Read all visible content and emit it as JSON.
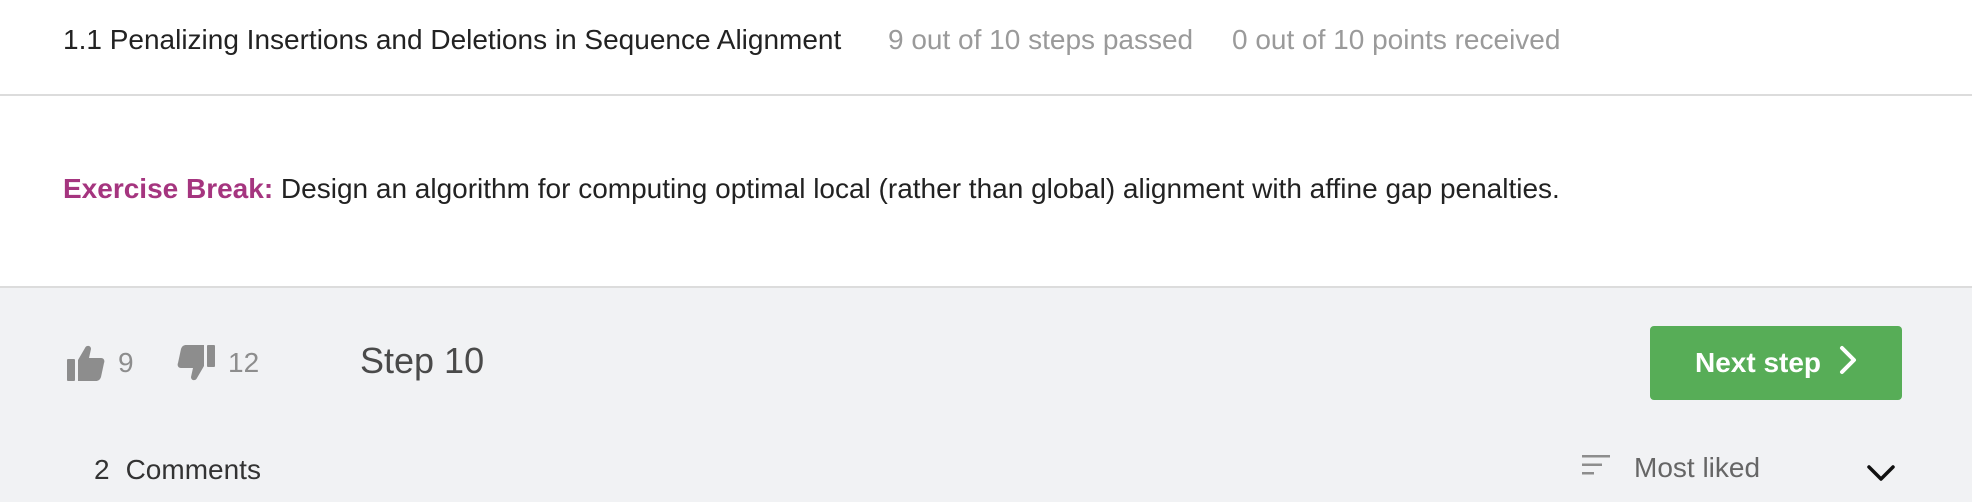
{
  "header": {
    "lesson_title": "1.1 Penalizing Insertions and Deletions in Sequence Alignment",
    "steps_passed": "9 out of 10 steps passed",
    "points_received": "0 out of 10 points  received"
  },
  "content": {
    "exercise_label": "Exercise Break:",
    "exercise_text": " Design an algorithm for computing optimal local (rather than global) alignment with affine gap penalties."
  },
  "footer": {
    "likes": "9",
    "dislikes": "12",
    "step_label": "Step 10",
    "next_button": "Next step",
    "comments_count": "2",
    "comments_label": "Comments",
    "sort_label": "Most liked"
  },
  "icons": {
    "like": "thumbs-up-icon",
    "dislike": "thumbs-down-icon",
    "next": "chevron-right-icon",
    "sort": "sort-lines-icon",
    "dropdown": "chevron-down-icon"
  },
  "colors": {
    "accent_label": "#a5357f",
    "next_button_bg": "#57ad57",
    "footer_bg": "#f1f2f4",
    "muted_text": "#9a9a9a"
  }
}
